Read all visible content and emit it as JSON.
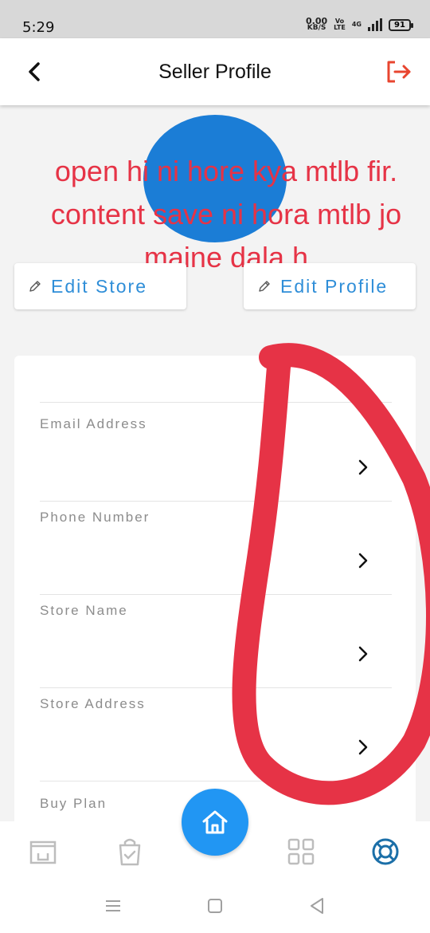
{
  "status_bar": {
    "time": "5:29",
    "net_speed_value": "0.00",
    "net_speed_unit": "KB/S",
    "volte_top": "Vo",
    "volte_bottom": "LTE",
    "network": "4G",
    "battery": "91"
  },
  "header": {
    "title": "Seller Profile",
    "accent_color": "#e8452f"
  },
  "annotation": {
    "text": "open hi ni hore kya mtlb fir. content save ni hora mtlb jo maine dala h",
    "color": "#e63346"
  },
  "actions": {
    "edit_store_label": "Edit Store",
    "edit_profile_label": "Edit Profile",
    "color": "#2f8ed8"
  },
  "fields": [
    {
      "label": "Email Address"
    },
    {
      "label": "Phone Number"
    },
    {
      "label": "Store Name"
    },
    {
      "label": "Store Address"
    },
    {
      "label": "Buy Plan"
    }
  ],
  "bottom_nav": {
    "items": [
      "store-icon",
      "shopping-bag-icon",
      "home-icon",
      "grid-icon",
      "support-icon"
    ],
    "fab_color": "#2196f3",
    "active_color": "#1b6fa8"
  }
}
